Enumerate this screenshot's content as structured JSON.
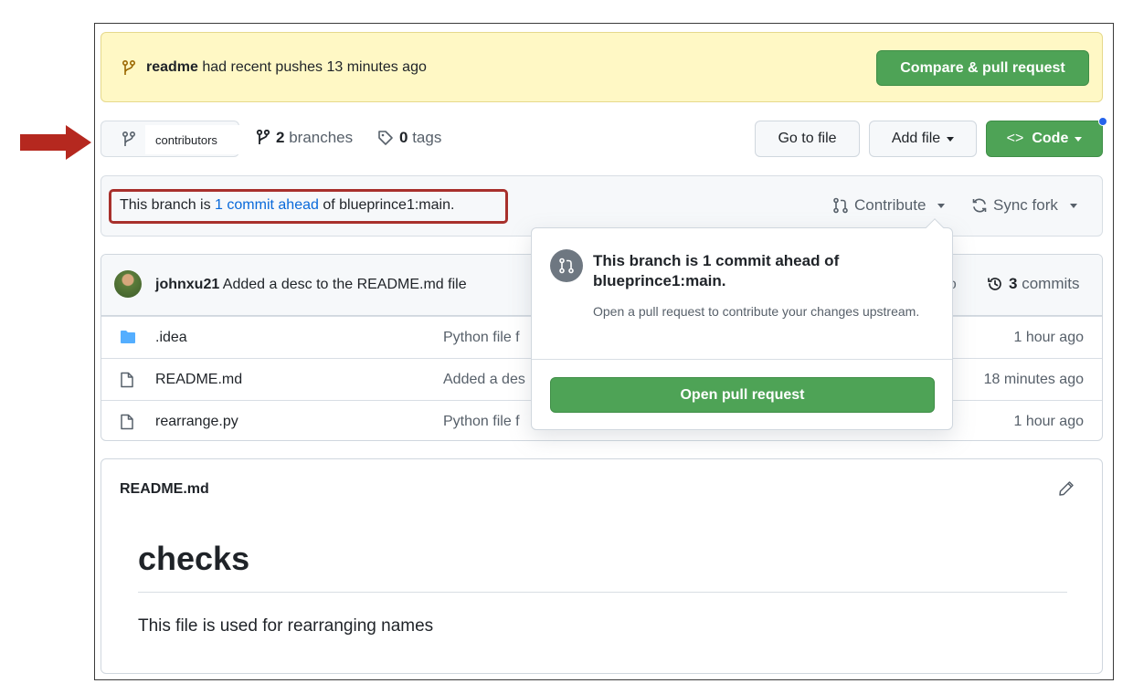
{
  "banner": {
    "branch": "readme",
    "message": "had recent pushes 13 minutes ago",
    "compare_button": "Compare & pull request",
    "icon": "git-branch-icon"
  },
  "toolbar": {
    "branch_selector": "contributors",
    "branches_count": "2",
    "branches_label": "branches",
    "tags_count": "0",
    "tags_label": "tags",
    "go_to_file": "Go to file",
    "add_file": "Add file",
    "code": "Code"
  },
  "ahead_bar": {
    "prefix": "This branch is ",
    "link": "1 commit ahead",
    "suffix": " of blueprince1:main.",
    "contribute": "Contribute",
    "sync_fork": "Sync fork"
  },
  "latest_commit": {
    "author": "johnxu21",
    "message": "Added a desc to the README.md file",
    "time_fragment": "go",
    "commits_count": "3",
    "commits_label": "commits"
  },
  "files": [
    {
      "type": "folder",
      "icon": "folder-icon",
      "name": ".idea",
      "message": "Python file f",
      "age": "1 hour ago"
    },
    {
      "type": "file",
      "icon": "file-icon",
      "name": "README.md",
      "message": "Added a des",
      "age": "18 minutes ago"
    },
    {
      "type": "file",
      "icon": "file-icon",
      "name": "rearrange.py",
      "message": "Python file f",
      "age": "1 hour ago"
    }
  ],
  "readme": {
    "filename": "README.md",
    "heading": "checks",
    "body": "This file is used for rearranging names"
  },
  "popover": {
    "title": "This branch is 1 commit ahead of blueprince1:main.",
    "description": "Open a pull request to contribute your changes upstream.",
    "button": "Open pull request"
  },
  "colors": {
    "green": "#4ea356",
    "banner_bg": "#fff8c5",
    "link_blue": "#0969da",
    "annotation_red": "#a8302c"
  }
}
